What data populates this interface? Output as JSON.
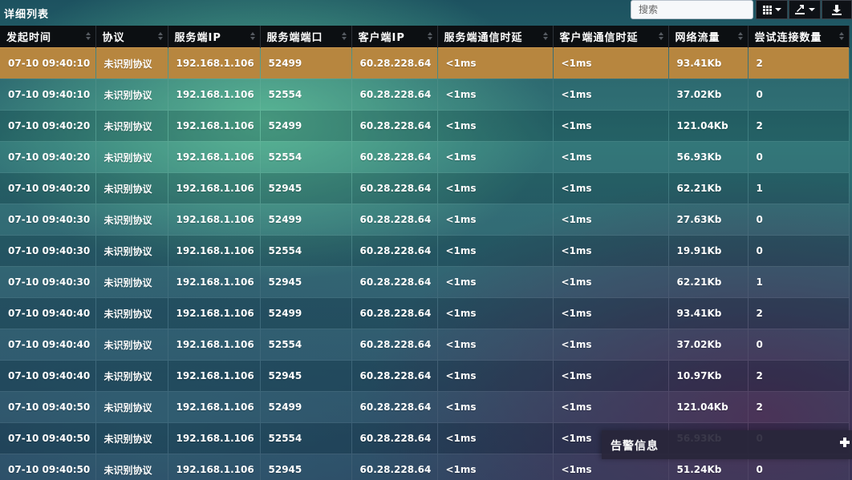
{
  "header": {
    "title": "详细列表",
    "search_placeholder": "搜索"
  },
  "toolbar": {
    "buttons": [
      {
        "icon": "grid-icon",
        "dropdown": true
      },
      {
        "icon": "export-icon",
        "dropdown": true
      },
      {
        "icon": "download-icon",
        "dropdown": false
      }
    ]
  },
  "table": {
    "columns": [
      "发起时间",
      "协议",
      "服务端IP",
      "服务端端口",
      "客户端IP",
      "服务端通信时延",
      "客户端通信时延",
      "网络流量",
      "尝试连接数量"
    ],
    "rows": [
      [
        "07-10 09:40:10",
        "未识别协议",
        "192.168.1.106",
        "52499",
        "60.28.228.64",
        "<1ms",
        "<1ms",
        "93.41Kb",
        "2"
      ],
      [
        "07-10 09:40:10",
        "未识别协议",
        "192.168.1.106",
        "52554",
        "60.28.228.64",
        "<1ms",
        "<1ms",
        "37.02Kb",
        "0"
      ],
      [
        "07-10 09:40:20",
        "未识别协议",
        "192.168.1.106",
        "52499",
        "60.28.228.64",
        "<1ms",
        "<1ms",
        "121.04Kb",
        "2"
      ],
      [
        "07-10 09:40:20",
        "未识别协议",
        "192.168.1.106",
        "52554",
        "60.28.228.64",
        "<1ms",
        "<1ms",
        "56.93Kb",
        "0"
      ],
      [
        "07-10 09:40:20",
        "未识别协议",
        "192.168.1.106",
        "52945",
        "60.28.228.64",
        "<1ms",
        "<1ms",
        "62.21Kb",
        "1"
      ],
      [
        "07-10 09:40:30",
        "未识别协议",
        "192.168.1.106",
        "52499",
        "60.28.228.64",
        "<1ms",
        "<1ms",
        "27.63Kb",
        "0"
      ],
      [
        "07-10 09:40:30",
        "未识别协议",
        "192.168.1.106",
        "52554",
        "60.28.228.64",
        "<1ms",
        "<1ms",
        "19.91Kb",
        "0"
      ],
      [
        "07-10 09:40:30",
        "未识别协议",
        "192.168.1.106",
        "52945",
        "60.28.228.64",
        "<1ms",
        "<1ms",
        "62.21Kb",
        "1"
      ],
      [
        "07-10 09:40:40",
        "未识别协议",
        "192.168.1.106",
        "52499",
        "60.28.228.64",
        "<1ms",
        "<1ms",
        "93.41Kb",
        "2"
      ],
      [
        "07-10 09:40:40",
        "未识别协议",
        "192.168.1.106",
        "52554",
        "60.28.228.64",
        "<1ms",
        "<1ms",
        "37.02Kb",
        "0"
      ],
      [
        "07-10 09:40:40",
        "未识别协议",
        "192.168.1.106",
        "52945",
        "60.28.228.64",
        "<1ms",
        "<1ms",
        "10.97Kb",
        "2"
      ],
      [
        "07-10 09:40:50",
        "未识别协议",
        "192.168.1.106",
        "52499",
        "60.28.228.64",
        "<1ms",
        "<1ms",
        "121.04Kb",
        "2"
      ],
      [
        "07-10 09:40:50",
        "未识别协议",
        "192.168.1.106",
        "52554",
        "60.28.228.64",
        "<1ms",
        "<1ms",
        "56.93Kb",
        "0"
      ],
      [
        "07-10 09:40:50",
        "未识别协议",
        "192.168.1.106",
        "52945",
        "60.28.228.64",
        "<1ms",
        "<1ms",
        "51.24Kb",
        "0"
      ]
    ],
    "selected_row": 0,
    "selected_color": "#b7863f"
  },
  "alert_panel": {
    "title": "告警信息",
    "icon": "plus-icon"
  }
}
